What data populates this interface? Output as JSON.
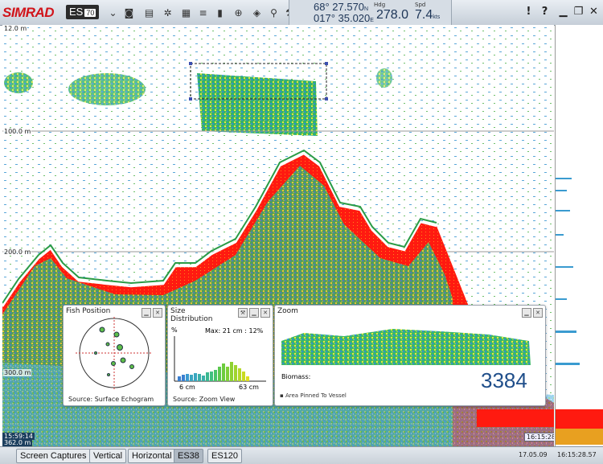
{
  "app": {
    "brand": "SIMRAD",
    "model": "ES",
    "model_sub": "70"
  },
  "toolbar": {
    "icons": [
      "chevron-down-icon",
      "camera-icon",
      "ruler-icon",
      "gear-icon",
      "monitor-icon",
      "bars-icon",
      "histogram-icon",
      "globe-icon",
      "drop-icon",
      "search-icon",
      "wrench-icon"
    ]
  },
  "nav": {
    "lat": "68° 27.570",
    "lat_hemi": "N",
    "lon": "017° 35.020",
    "lon_hemi": "E",
    "hdg_label": "Hdg",
    "hdg_value": "278.0",
    "spd_label": "Spd",
    "spd_value": "7.4",
    "spd_unit": "kts"
  },
  "window_buttons": {
    "alarm": "!",
    "help": "?"
  },
  "echogram": {
    "depth_labels": [
      "12.0 m",
      "100.0 m",
      "200.0 m",
      "300.0 m"
    ],
    "bottom_left_time": "15:59:14",
    "bottom_left_depth": "362.0 m",
    "bottom_right_time": "16:15:28"
  },
  "panels": {
    "fish_position": {
      "title": "Fish Position",
      "source": "Source: Surface Echogram"
    },
    "size_distribution": {
      "title": "Size",
      "title2": "Distribution",
      "yunit": "%",
      "max_label": "Max: 21 cm : 12%",
      "x_min": "6 cm",
      "x_max": "63 cm",
      "source": "Source: Zoom View"
    },
    "zoom": {
      "title": "Zoom",
      "biomass_label": "Biomass:",
      "biomass_value": "3384",
      "pinned_label": "Area Pinned To Vessel"
    }
  },
  "bottom_tabs": {
    "tabs": [
      "Screen Captures",
      "Vertical",
      "Horizontal",
      "ES38",
      "ES120"
    ],
    "active": "ES38",
    "date": "17.05.09",
    "time": "16:15:28.57"
  }
}
